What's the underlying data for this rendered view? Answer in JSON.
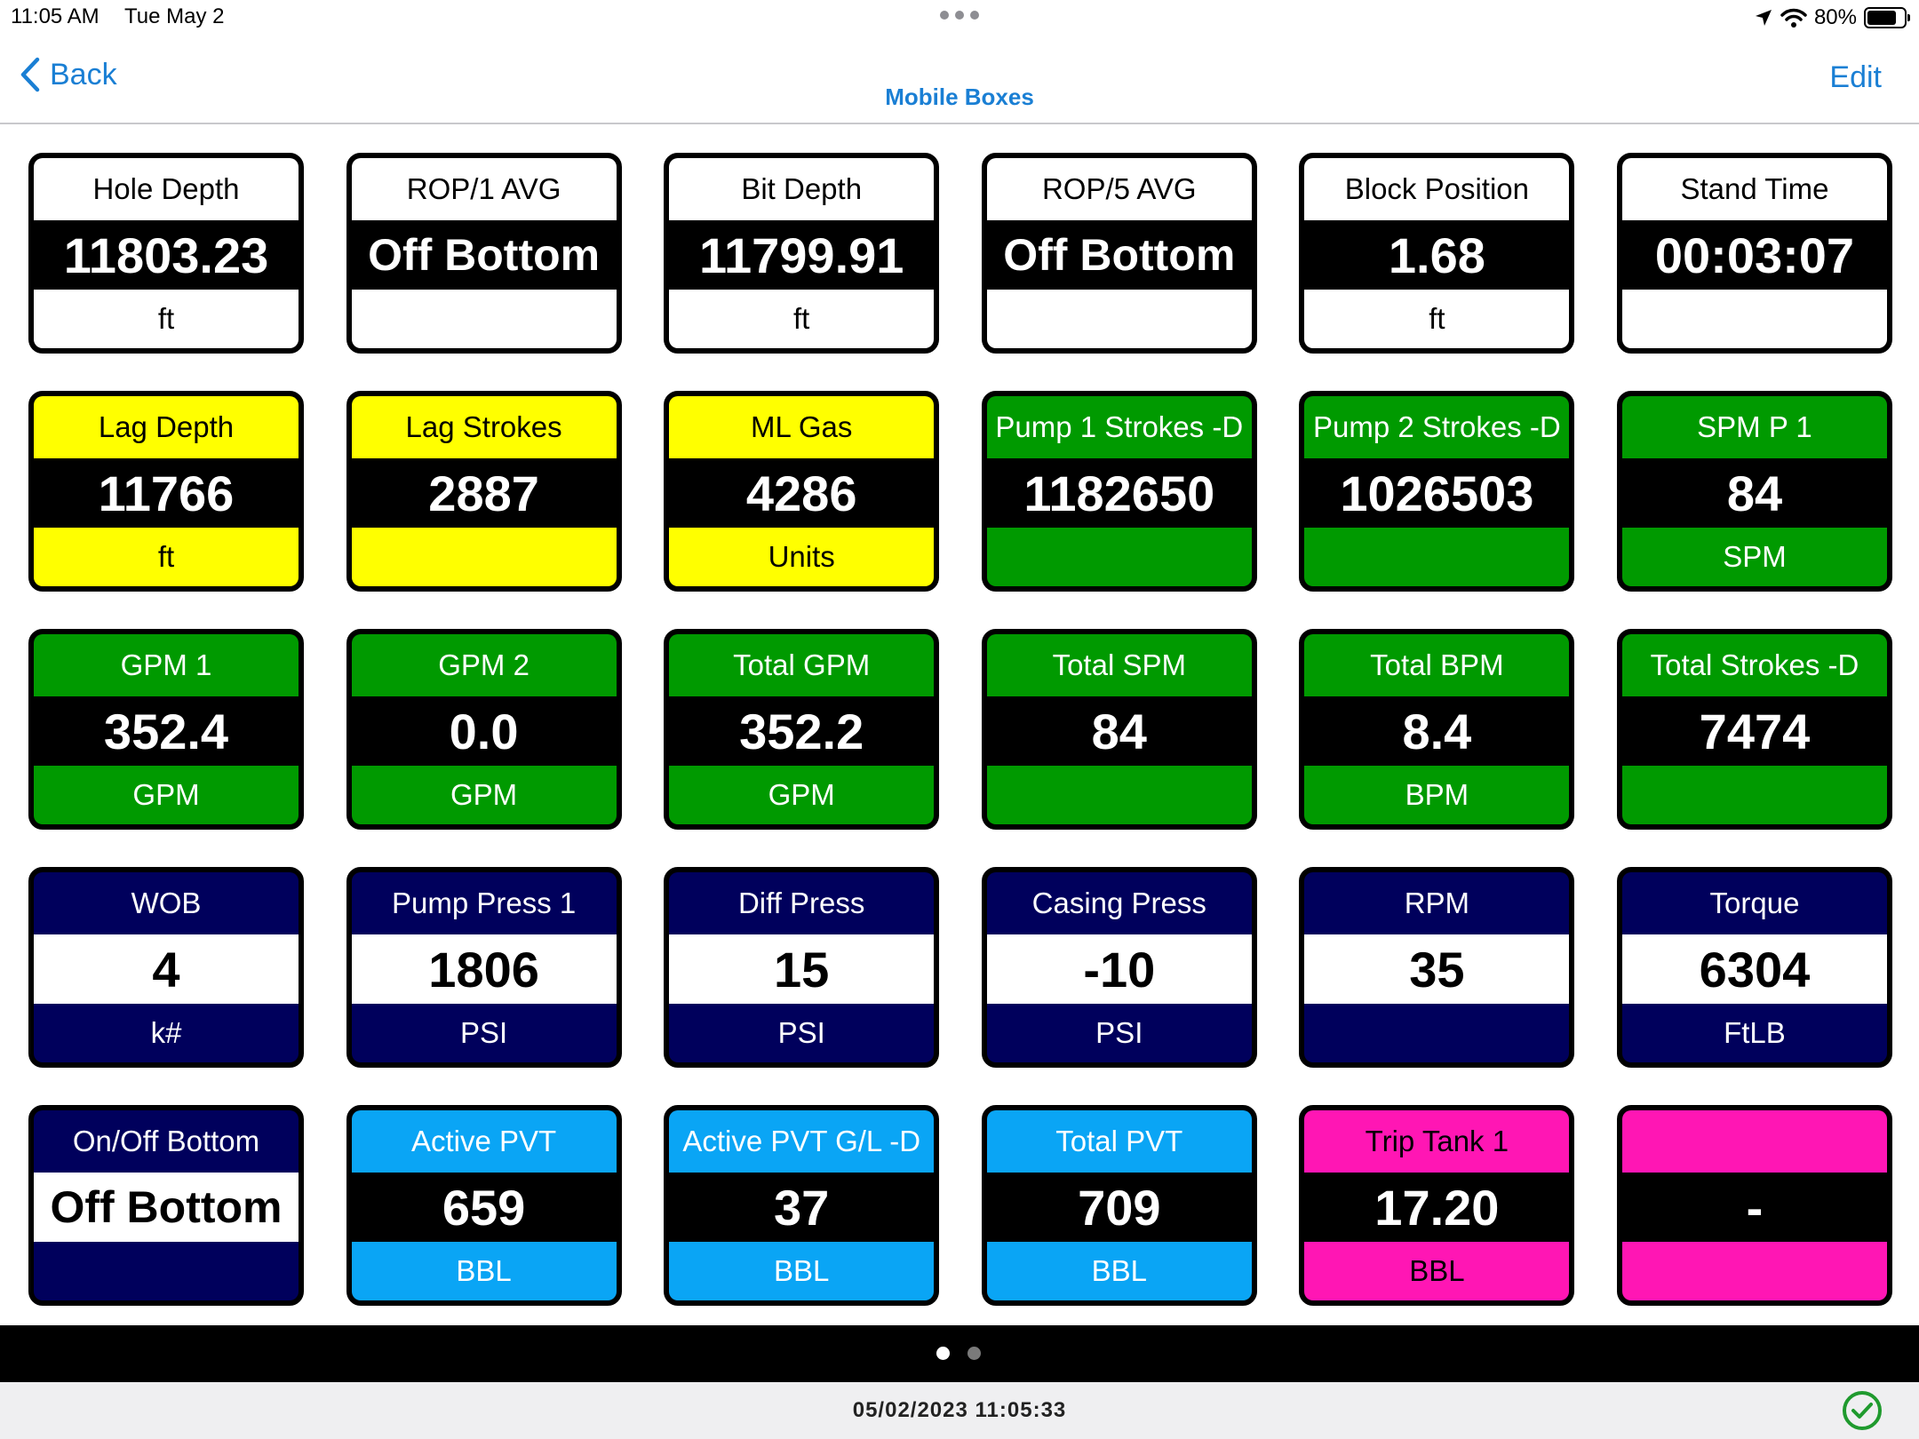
{
  "status_bar": {
    "time": "11:05 AM",
    "date": "Tue May 2",
    "battery": "80%"
  },
  "nav": {
    "back_label": "Back",
    "title": "Mobile Boxes",
    "edit_label": "Edit"
  },
  "colors": {
    "white": "#ffffff",
    "yellow": "#ffff00",
    "green": "#009a00",
    "navy": "#00005c",
    "sky": "#0aa5f5",
    "magenta": "#ff16b4"
  },
  "boxes": [
    {
      "label": "Hole Depth",
      "value": "11803.23",
      "unit": "ft",
      "theme": "white"
    },
    {
      "label": "ROP/1 AVG",
      "value": "Off Bottom",
      "unit": "",
      "theme": "white"
    },
    {
      "label": "Bit Depth",
      "value": "11799.91",
      "unit": "ft",
      "theme": "white"
    },
    {
      "label": "ROP/5 AVG",
      "value": "Off Bottom",
      "unit": "",
      "theme": "white"
    },
    {
      "label": "Block Position",
      "value": "1.68",
      "unit": "ft",
      "theme": "white"
    },
    {
      "label": "Stand Time",
      "value": "00:03:07",
      "unit": "",
      "theme": "white"
    },
    {
      "label": "Lag Depth",
      "value": "11766",
      "unit": "ft",
      "theme": "yellow"
    },
    {
      "label": "Lag Strokes",
      "value": "2887",
      "unit": "",
      "theme": "yellow"
    },
    {
      "label": "ML Gas",
      "value": "4286",
      "unit": "Units",
      "theme": "yellow"
    },
    {
      "label": "Pump 1 Strokes -D",
      "value": "1182650",
      "unit": "",
      "theme": "green"
    },
    {
      "label": "Pump 2 Strokes -D",
      "value": "1026503",
      "unit": "",
      "theme": "green"
    },
    {
      "label": "SPM P 1",
      "value": "84",
      "unit": "SPM",
      "theme": "green"
    },
    {
      "label": "GPM 1",
      "value": "352.4",
      "unit": "GPM",
      "theme": "green"
    },
    {
      "label": "GPM 2",
      "value": "0.0",
      "unit": "GPM",
      "theme": "green"
    },
    {
      "label": "Total GPM",
      "value": "352.2",
      "unit": "GPM",
      "theme": "green"
    },
    {
      "label": "Total SPM",
      "value": "84",
      "unit": "",
      "theme": "green"
    },
    {
      "label": "Total BPM",
      "value": "8.4",
      "unit": "BPM",
      "theme": "green"
    },
    {
      "label": "Total Strokes -D",
      "value": "7474",
      "unit": "",
      "theme": "green"
    },
    {
      "label": "WOB",
      "value": "4",
      "unit": "k#",
      "theme": "navy"
    },
    {
      "label": "Pump Press 1",
      "value": "1806",
      "unit": "PSI",
      "theme": "navy"
    },
    {
      "label": "Diff Press",
      "value": "15",
      "unit": "PSI",
      "theme": "navy"
    },
    {
      "label": "Casing Press",
      "value": "-10",
      "unit": "PSI",
      "theme": "navy"
    },
    {
      "label": "RPM",
      "value": "35",
      "unit": "",
      "theme": "navy"
    },
    {
      "label": "Torque",
      "value": "6304",
      "unit": "FtLB",
      "theme": "navy"
    },
    {
      "label": "On/Off Bottom",
      "value": "Off Bottom",
      "unit": "",
      "theme": "navy"
    },
    {
      "label": "Active PVT",
      "value": "659",
      "unit": "BBL",
      "theme": "sky"
    },
    {
      "label": "Active PVT G/L -D",
      "value": "37",
      "unit": "BBL",
      "theme": "sky"
    },
    {
      "label": "Total PVT",
      "value": "709",
      "unit": "BBL",
      "theme": "sky"
    },
    {
      "label": "Trip Tank 1",
      "value": "17.20",
      "unit": "BBL",
      "theme": "magenta"
    },
    {
      "label": "",
      "value": "-",
      "unit": "",
      "theme": "magenta"
    }
  ],
  "pager": {
    "pages": 2,
    "current": 1
  },
  "footer": {
    "timestamp": "05/02/2023 11:05:33",
    "status_icon": "check-circle-icon"
  }
}
